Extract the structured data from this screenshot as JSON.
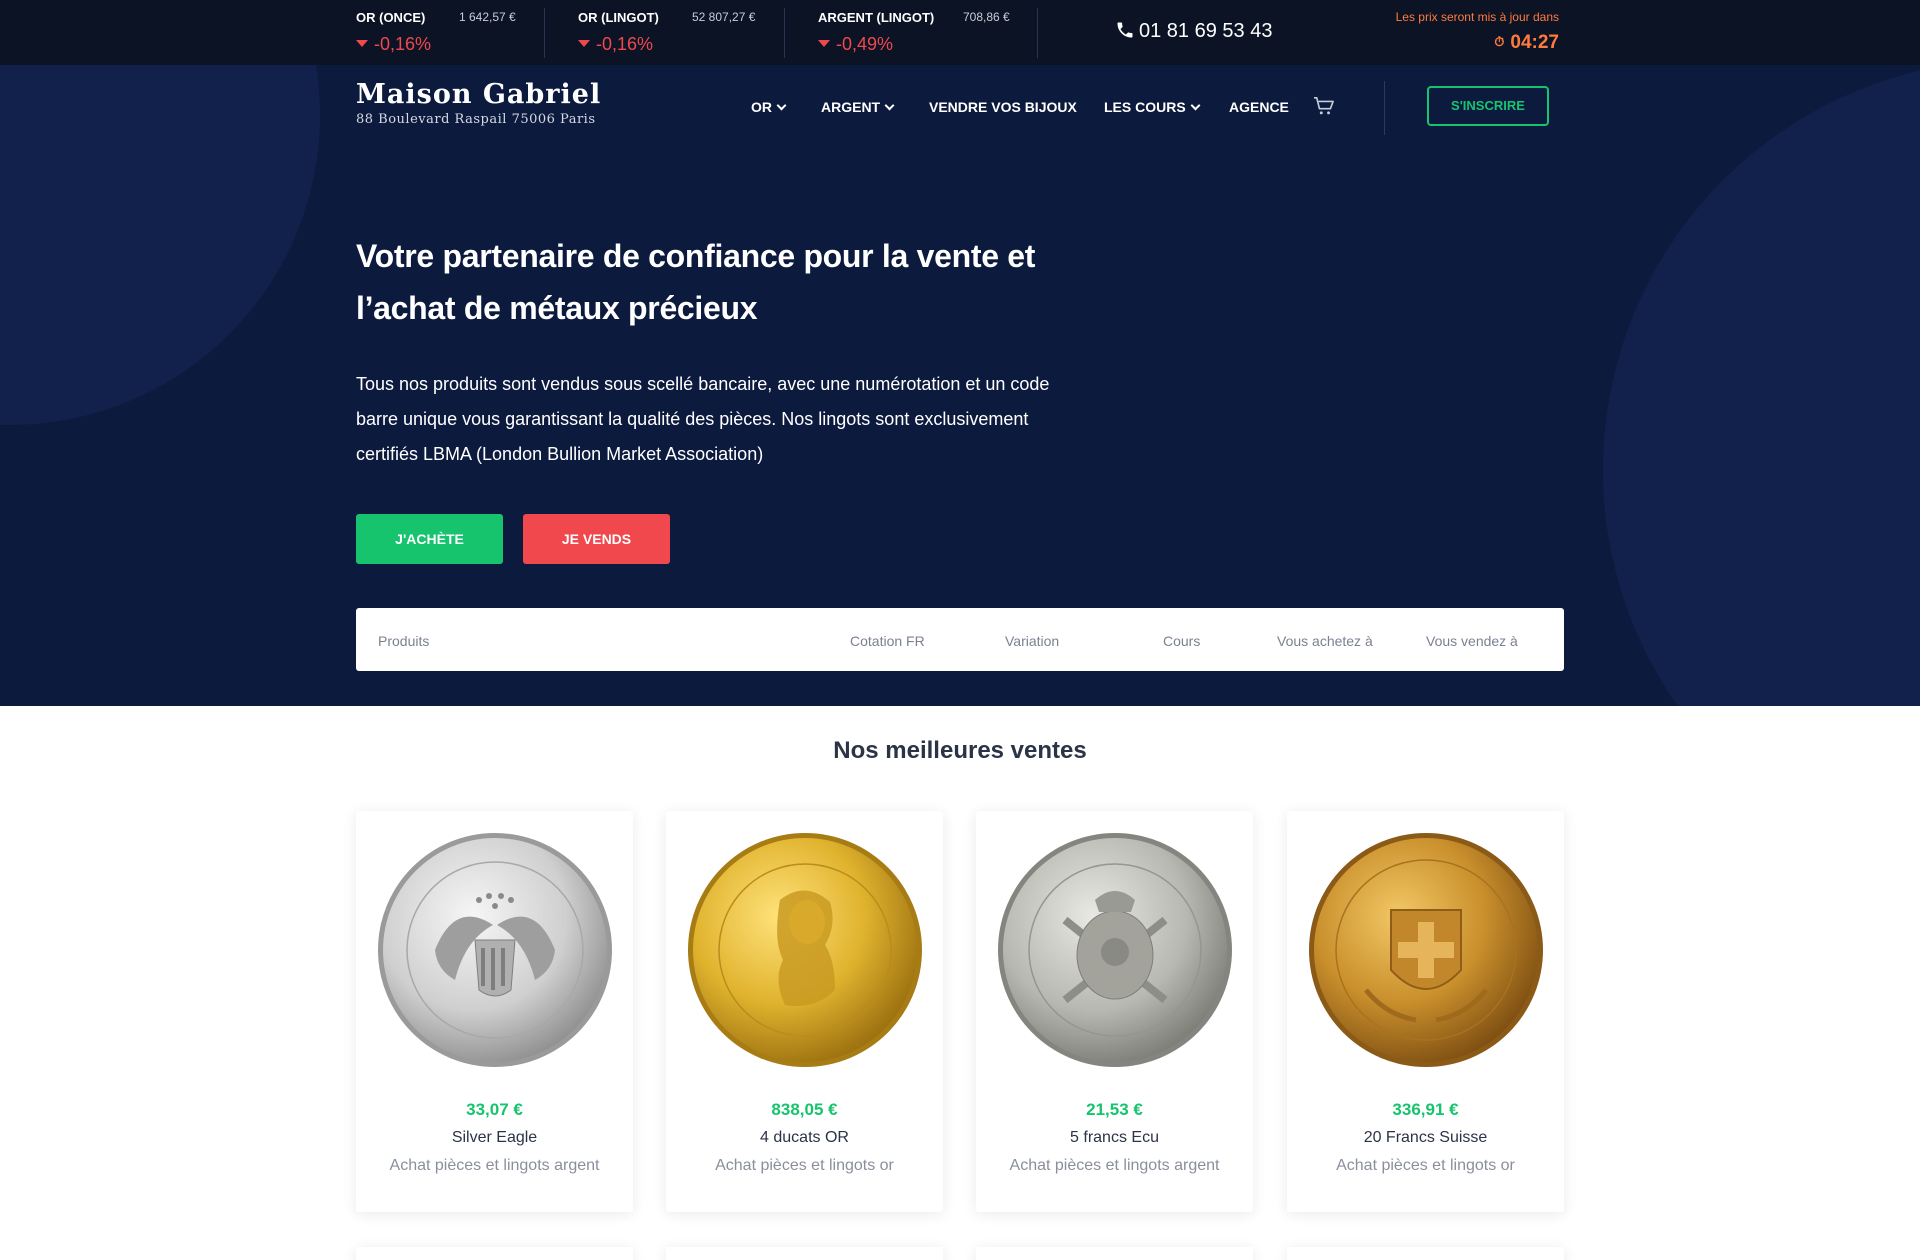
{
  "ticker": {
    "items": [
      {
        "label": "OR (ONCE)",
        "price": "1 642,57 €",
        "change": "-0,16%"
      },
      {
        "label": "OR (LINGOT)",
        "price": "52 807,27 €",
        "change": "-0,16%"
      },
      {
        "label": "ARGENT (LINGOT)",
        "price": "708,86 €",
        "change": "-0,49%"
      }
    ],
    "phone": "01 81 69 53 43",
    "update_label": "Les prix seront mis à jour dans",
    "update_time": "04:27",
    "colors": {
      "down": "#f0484c",
      "timer": "#ff7a3d"
    }
  },
  "header": {
    "brand_name": "Maison Gabriel",
    "brand_address": "88 Boulevard Raspail 75006 Paris",
    "nav": [
      {
        "label": "OR",
        "has_dropdown": true
      },
      {
        "label": "ARGENT",
        "has_dropdown": true
      },
      {
        "label": "VENDRE VOS BIJOUX",
        "has_dropdown": false
      },
      {
        "label": "LES COURS",
        "has_dropdown": true
      },
      {
        "label": "AGENCE",
        "has_dropdown": false
      }
    ],
    "cart_icon": "cart-icon",
    "signup_label": "S'INSCRIRE"
  },
  "hero": {
    "title": "Votre partenaire de confiance pour la vente et l’achat de métaux précieux",
    "text": "Tous nos produits sont vendus sous scellé bancaire, avec une numérotation et un code barre unique vous garantissant la qualité des pièces. Nos lingots sont exclusivement certifiés LBMA (London Bullion Market Association)",
    "buy_label": "J'ACHÈTE",
    "sell_label": "JE VENDS",
    "table_headers": [
      "Produits",
      "Cotation FR",
      "Variation",
      "Cours",
      "Vous achetez à",
      "Vous vendez à"
    ]
  },
  "best_sellers": {
    "title": "Nos meilleures ventes",
    "products": [
      {
        "price": "33,07 €",
        "name": "Silver Eagle",
        "category": "Achat pièces et lingots argent",
        "coin": "silver-eagle-coin-image"
      },
      {
        "price": "838,05 €",
        "name": "4 ducats OR",
        "category": "Achat pièces et lingots or",
        "coin": "4-ducats-gold-coin-image"
      },
      {
        "price": "21,53 €",
        "name": "5 francs Ecu",
        "category": "Achat pièces et lingots argent",
        "coin": "5-francs-ecu-coin-image"
      },
      {
        "price": "336,91 €",
        "name": "20 Francs Suisse",
        "category": "Achat pièces et lingots or",
        "coin": "20-francs-suisse-coin-image"
      }
    ]
  },
  "colors": {
    "navy": "#0c1a3e",
    "green": "#16c46e",
    "red": "#f0484c"
  }
}
